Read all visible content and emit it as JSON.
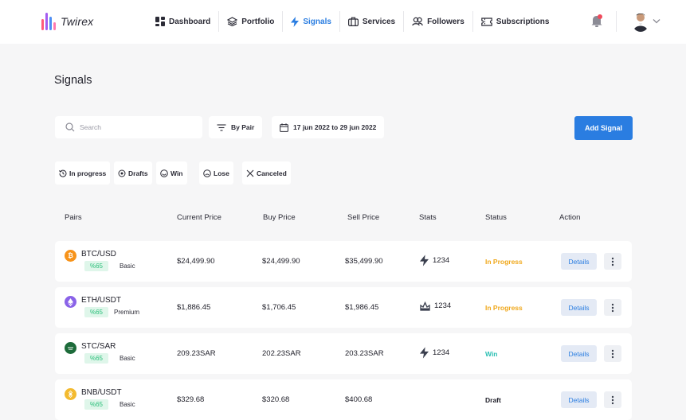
{
  "app": {
    "name": "Twirex"
  },
  "nav": {
    "items": [
      {
        "label": "Dashboard",
        "icon": "dashboard-icon",
        "active": false
      },
      {
        "label": "Portfolio",
        "icon": "layers-icon",
        "active": false
      },
      {
        "label": "Signals",
        "icon": "bolt-icon",
        "active": true
      },
      {
        "label": "Services",
        "icon": "briefcase-icon",
        "active": false
      },
      {
        "label": "Followers",
        "icon": "users-icon",
        "active": false
      },
      {
        "label": "Subscriptions",
        "icon": "ticket-icon",
        "active": false
      }
    ]
  },
  "page": {
    "title": "Signals"
  },
  "filters": {
    "search_placeholder": "Search",
    "by_pair": "By Pair",
    "date_range": "17 jun 2022 to 29 jun 2022",
    "add_signal": "Add Signal"
  },
  "status_filters": [
    "In progress",
    "Drafts",
    "Win",
    "Lose",
    "Canceled"
  ],
  "table": {
    "headers": [
      "Pairs",
      "Current Price",
      "Buy Price",
      "Sell Price",
      "Stats",
      "Status",
      "Action"
    ],
    "details_label": "Details",
    "rows": [
      {
        "pair": "BTC/USD",
        "coin_icon": "bitcoin-icon",
        "coin_color": "#f7931a",
        "badge": "%65",
        "plan": "Basic",
        "current": "$24,499.90",
        "buy": "$24,499.90",
        "sell": "$35,499.90",
        "stats": "1234",
        "stats_icon": "bolt-icon",
        "status": "In Progress",
        "status_color": "#f0a81c"
      },
      {
        "pair": "ETH/USDT",
        "coin_icon": "ethereum-icon",
        "coin_color": "#8a63e8",
        "badge": "%65",
        "plan": "Premium",
        "current": "$1,886.45",
        "buy": "$1,706.45",
        "sell": "$1,986.45",
        "stats": "1234",
        "stats_icon": "crown-icon",
        "status": "In Progress",
        "status_color": "#f0a81c"
      },
      {
        "pair": "STC/SAR",
        "coin_icon": "saudi-flag-icon",
        "coin_color": "#1d6b3a",
        "badge": "%65",
        "plan": "Basic",
        "current": "209.23SAR",
        "buy": "202.23SAR",
        "sell": "203.23SAR",
        "stats": "1234",
        "stats_icon": "bolt-icon",
        "status": "Win",
        "status_color": "#2bbfb3"
      },
      {
        "pair": "BNB/USDT",
        "coin_icon": "binance-icon",
        "coin_color": "#f3ba2f",
        "badge": "%65",
        "plan": "Basic",
        "current": "$329.68",
        "buy": "$320.68",
        "sell": "$400.68",
        "stats": "",
        "stats_icon": "",
        "status": "Draft",
        "status_color": "#1e1e28"
      }
    ]
  },
  "colors": {
    "accent": "#2a7de1",
    "badge_bg": "#dff6ea",
    "badge_text": "#2bbf7a"
  }
}
